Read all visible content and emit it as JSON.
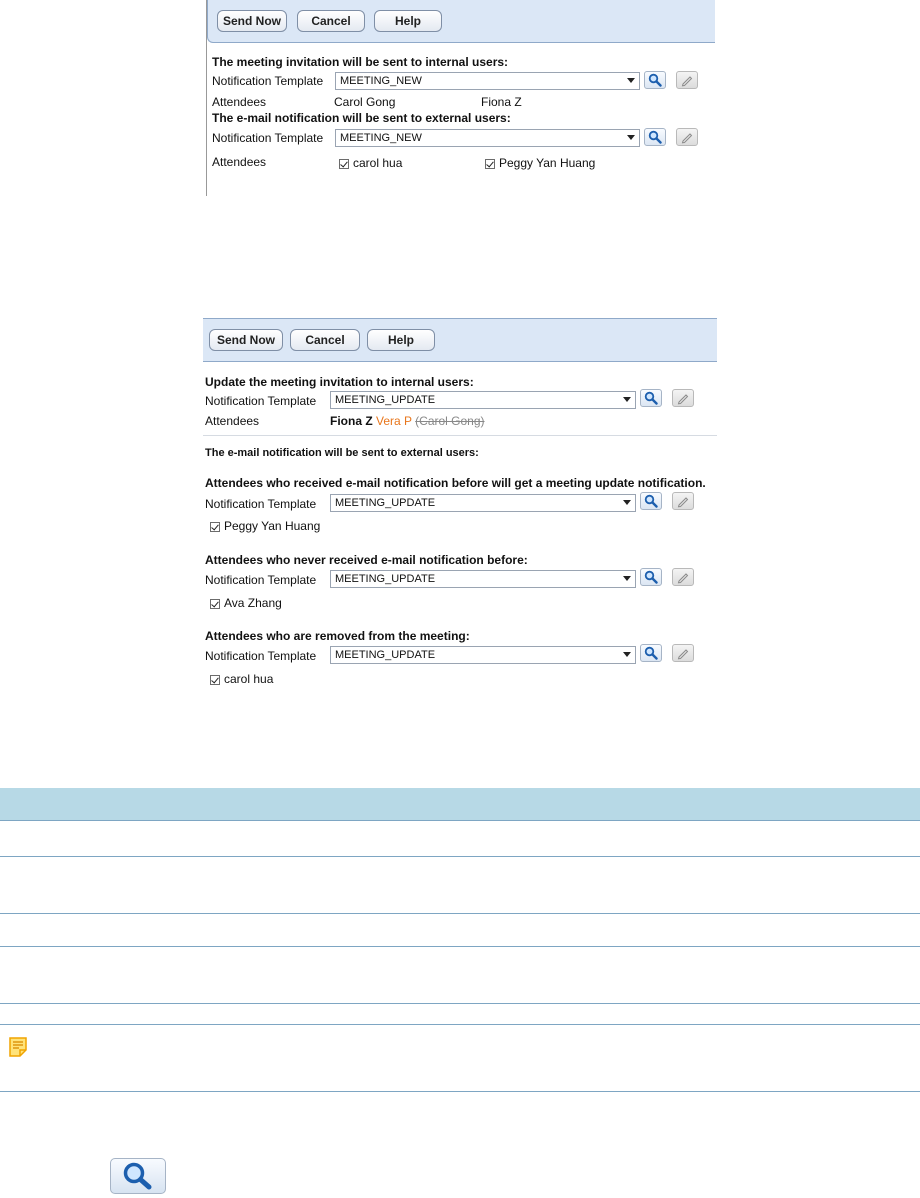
{
  "panel1": {
    "buttons": {
      "send": "Send Now",
      "cancel": "Cancel",
      "help": "Help"
    },
    "internal_heading": "The meeting invitation will be sent to internal users:",
    "template_label": "Notification Template",
    "internal_template": "MEETING_NEW",
    "attendees_label": "Attendees",
    "internal_attendees": [
      "Carol Gong",
      "Fiona Z"
    ],
    "external_heading": "The e-mail notification will be sent to external users:",
    "external_template": "MEETING_NEW",
    "external_attendees": [
      "carol hua",
      "Peggy Yan Huang"
    ]
  },
  "panel2": {
    "buttons": {
      "send": "Send Now",
      "cancel": "Cancel",
      "help": "Help"
    },
    "update_heading": "Update the meeting invitation to internal users:",
    "template_label": "Notification Template",
    "update_template": "MEETING_UPDATE",
    "attendees_label": "Attendees",
    "attendee_existing": "Fiona Z",
    "attendee_added": "Vera P",
    "attendee_removed": "(Carol Gong)",
    "external_heading": "The e-mail notification will be sent to external users:",
    "received_heading": "Attendees who received e-mail notification before will get a meeting update notification.",
    "received_template": "MEETING_UPDATE",
    "received_attendee": "Peggy Yan Huang",
    "never_heading": "Attendees who never received e-mail notification before:",
    "never_template": "MEETING_UPDATE",
    "never_attendee": "Ava Zhang",
    "removed_heading": "Attendees who are removed from the meeting:",
    "removed_template": "MEETING_UPDATE",
    "removed_attendee": "carol hua"
  },
  "colors": {
    "toolbar": "#dbe7f6",
    "table_header": "#b7d9e6",
    "row_line": "#7ea6c3",
    "added_attendee": "#e8761c",
    "removed_attendee": "#888888"
  }
}
